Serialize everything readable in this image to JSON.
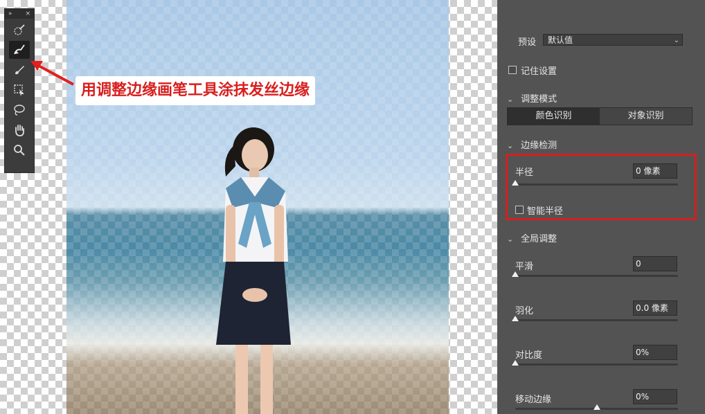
{
  "toolbar": {
    "header_expand": "»",
    "header_close": "×",
    "tools": [
      {
        "name": "quick-selection-icon"
      },
      {
        "name": "refine-edge-brush-icon",
        "active": true
      },
      {
        "name": "brush-icon"
      },
      {
        "name": "object-selection-icon"
      },
      {
        "name": "lasso-icon"
      },
      {
        "name": "hand-icon"
      },
      {
        "name": "zoom-icon"
      }
    ]
  },
  "annotation": {
    "text": "用调整边缘画笔工具涂抹发丝边缘",
    "color": "#d81e1e"
  },
  "panel": {
    "preset_label": "预设",
    "preset_value": "默认值",
    "remember_label": "记住设置",
    "adjust_mode": {
      "title": "调整模式",
      "options": [
        "颜色识别",
        "对象识别"
      ]
    },
    "edge_detection": {
      "title": "边缘检测",
      "radius_label": "半径",
      "radius_value": "0 像素",
      "radius_level": 0,
      "smart_radius_label": "智能半径"
    },
    "global": {
      "title": "全局调整",
      "smooth_label": "平滑",
      "smooth_value": "0",
      "smooth_level": 0,
      "feather_label": "羽化",
      "feather_value": "0.0 像素",
      "feather_level": 0,
      "contrast_label": "对比度",
      "contrast_value": "0%",
      "contrast_level": 0,
      "shift_label": "移动边缘",
      "shift_value": "0%",
      "shift_level": 0.5
    },
    "highlight_color": "#d4201f"
  }
}
